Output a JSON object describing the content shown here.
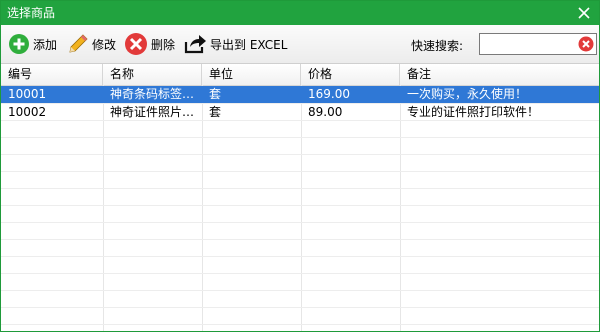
{
  "window": {
    "title": "选择商品"
  },
  "toolbar": {
    "add_label": "添加",
    "edit_label": "修改",
    "delete_label": "删除",
    "export_label": "导出到 EXCEL",
    "search_label": "快速搜索:",
    "search_value": ""
  },
  "table": {
    "columns": [
      "编号",
      "名称",
      "单位",
      "价格",
      "备注"
    ],
    "rows": [
      {
        "id": "10001",
        "name": "神奇条码标签…",
        "unit": "套",
        "price": "169.00",
        "note": "一次购买，永久使用！",
        "selected": true
      },
      {
        "id": "10002",
        "name": "神奇证件照片…",
        "unit": "套",
        "price": "89.00",
        "note": "专业的证件照打印软件！",
        "selected": false
      }
    ]
  },
  "colors": {
    "title_bar": "#21a33f",
    "selection": "#2f78d6"
  },
  "icons": [
    "close-icon",
    "add-icon",
    "edit-icon",
    "delete-icon",
    "export-icon",
    "clear-search-icon"
  ]
}
